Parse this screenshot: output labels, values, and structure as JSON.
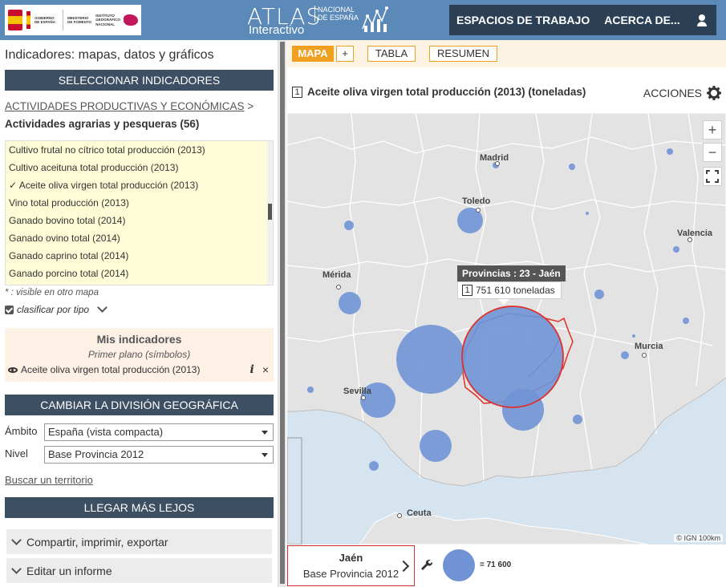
{
  "header": {
    "gov_text": "GOBIERNO DE ESPAÑA",
    "ministry_text": "MINISTERIO DE FOMENTO",
    "ign_text": "INSTITUTO GEOGRÁFICO NACIONAL",
    "atlas_title": "ATLAS",
    "atlas_nacional": "NACIONAL DE ESPAÑA",
    "atlas_sub": "Interactivo",
    "nav": [
      "ESPACIOS DE TRABAJO",
      "ACERCA DE..."
    ]
  },
  "left": {
    "title": "Indicadores: mapas, datos y gráficos",
    "sel_indicadores": "SELECCIONAR INDICADORES",
    "category": "ACTIVIDADES PRODUCTIVAS Y ECONÓMICAS",
    "category_sep": " >",
    "subcategory": "Actividades agrarias y pesqueras (56)",
    "indicators": [
      "Cultivo frutal no cítrico total producción (2013)",
      "Cultivo aceituna total producción (2013)",
      "✓ Aceite oliva virgen total producción (2013)",
      "Vino total producción (2013)",
      "Ganado bovino total (2014)",
      "Ganado ovino total (2014)",
      "Ganado caprino total (2014)",
      "Ganado porcino total (2014)"
    ],
    "note": "* : visible en otro mapa",
    "classify": "clasificar por tipo",
    "mis_title": "Mis indicadores",
    "mis_sub": "Primer plano (símbolos)",
    "mis_item": "Aceite oliva virgen total producción (2013)",
    "mis_info": "i",
    "mis_close": "×",
    "cambiar": "CAMBIAR LA DIVISIÓN GEOGRÁFICA",
    "ambito_label": "Ámbito",
    "ambito_value": "España (vista compacta)",
    "nivel_label": "Nivel",
    "nivel_value": "Base Provincia 2012",
    "buscar": "Buscar un territorio",
    "llegar": "LLEGAR MÁS LEJOS",
    "compartir": "Compartir, imprimir, exportar",
    "editar": "Editar un informe"
  },
  "right": {
    "tabs": [
      "MAPA",
      "+",
      "TABLA",
      "RESUMEN"
    ],
    "indicator_num": "1",
    "indicator_title": "Aceite oliva virgen total producción (2013) (toneladas)",
    "acciones": "ACCIONES",
    "zoom_in": "+",
    "zoom_out": "−",
    "tooltip_head": "Provincias : 23 - Jaén",
    "tooltip_num": "1",
    "tooltip_value": "751 610 toneladas",
    "attribution": "© IGN  100km",
    "cities": [
      "Madrid",
      "Toledo",
      "Valencia",
      "Mérida",
      "Murcia",
      "Sevilla",
      "Ceuta"
    ],
    "selected_name": "Jaén",
    "selected_level": "Base Provincia 2012",
    "legend_value": "= 71 600"
  },
  "colors": {
    "header": "#5b89b8",
    "nav": "#2b3f55",
    "section": "#3d4f63",
    "accent": "#f0a020",
    "symbol": "#7093d6",
    "highlight": "#d32f2f"
  }
}
